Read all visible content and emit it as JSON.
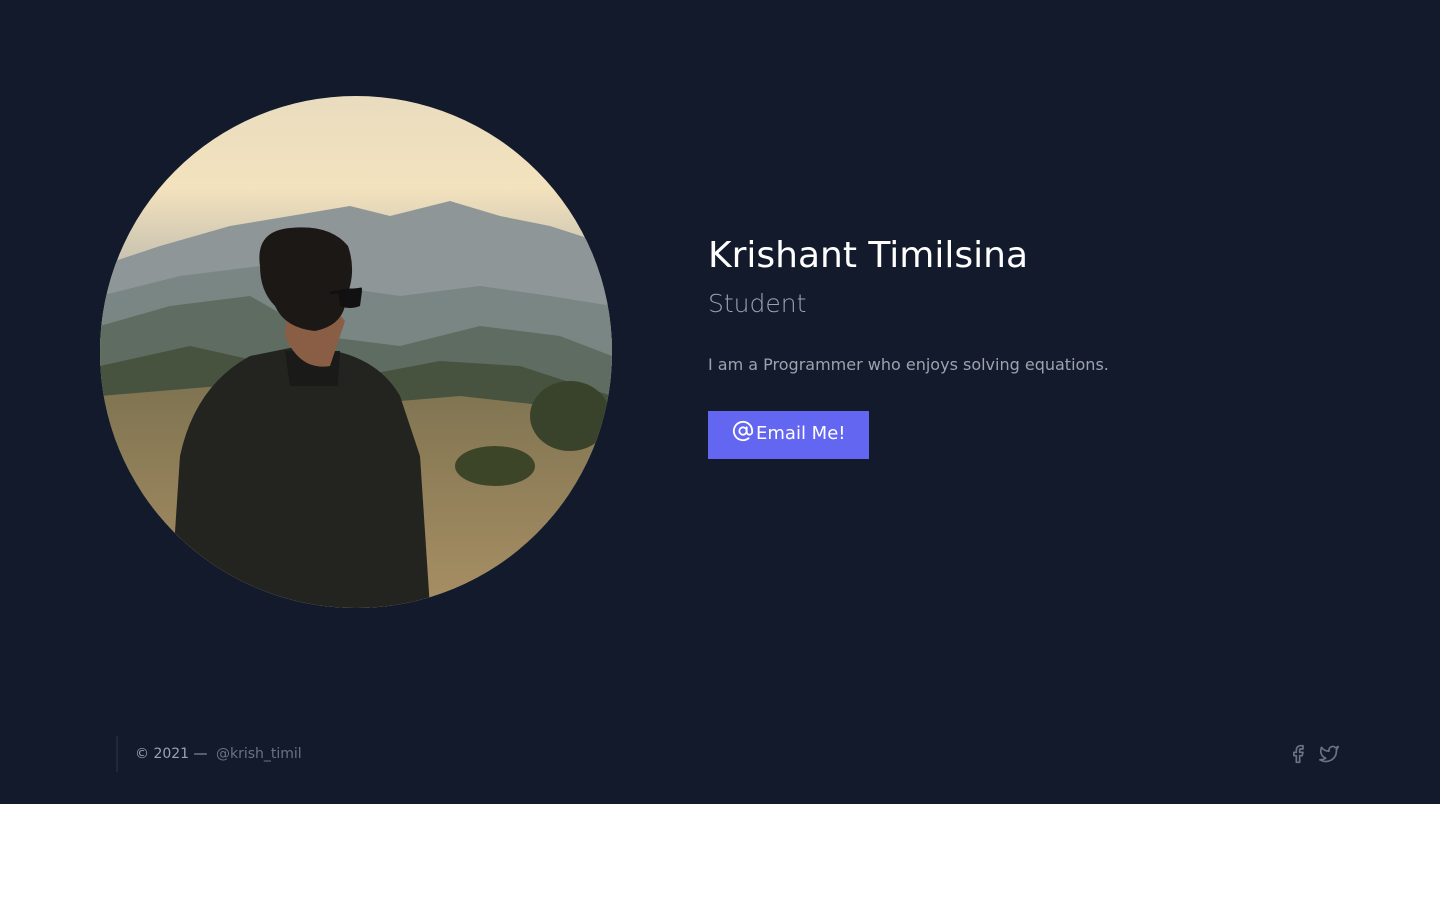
{
  "profile": {
    "name": "Krishant Timilsina",
    "role": "Student",
    "bio": "I am a Programmer who enjoys solving equations.",
    "email_button": "Email Me!"
  },
  "footer": {
    "copyright": "© 2021 —",
    "handle": "@krish_timil"
  },
  "icons": {
    "email": "at-sign-icon",
    "facebook": "facebook-icon",
    "twitter": "twitter-icon"
  },
  "colors": {
    "background": "#131a2b",
    "accent": "#6366f1",
    "text_primary": "#ffffff",
    "text_muted": "#9ca3af"
  }
}
